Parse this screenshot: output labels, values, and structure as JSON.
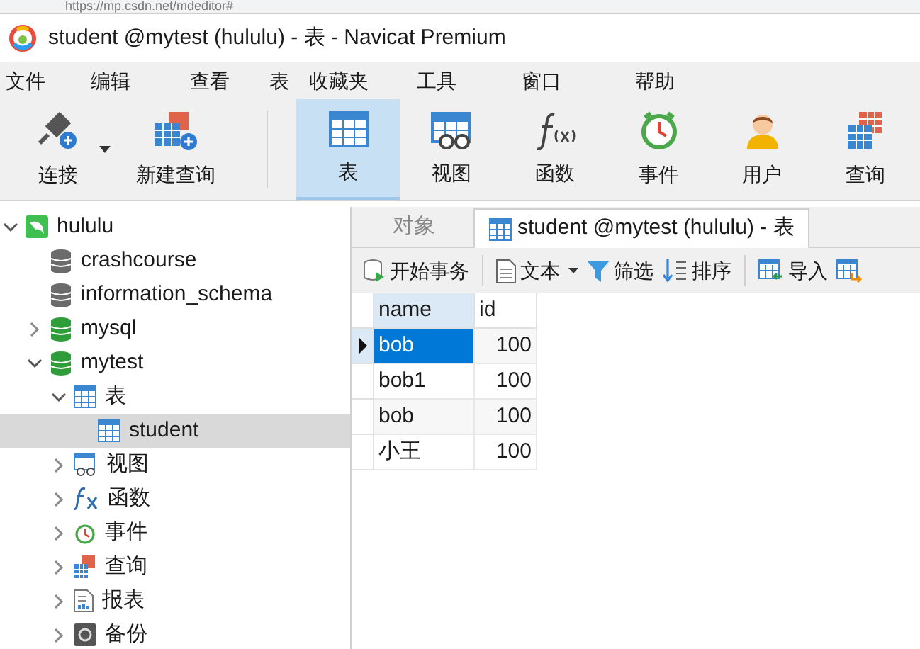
{
  "browser_url": "https://mp.csdn.net/mdeditor#",
  "window": {
    "title": "student @mytest (hululu) - 表 - Navicat Premium"
  },
  "menu": [
    "文件",
    "编辑",
    "查看",
    "表",
    "收藏夹",
    "工具",
    "窗口",
    "帮助"
  ],
  "toolbar": [
    {
      "label": "连接",
      "selected": false,
      "dropdown": true
    },
    {
      "label": "新建查询",
      "selected": false
    },
    {
      "label": "表",
      "selected": true
    },
    {
      "label": "视图",
      "selected": false
    },
    {
      "label": "函数",
      "selected": false
    },
    {
      "label": "事件",
      "selected": false
    },
    {
      "label": "用户",
      "selected": false
    },
    {
      "label": "查询",
      "selected": false
    }
  ],
  "sidebar": {
    "items": [
      {
        "kind": "server",
        "label": "hululu",
        "expanded": true,
        "selected": false,
        "children": [
          {
            "kind": "database",
            "label": "crashcourse",
            "open": false,
            "selected": false
          },
          {
            "kind": "database",
            "label": "information_schema",
            "open": false,
            "selected": false
          },
          {
            "kind": "database",
            "label": "mysql",
            "open": true,
            "expanded": false,
            "selected": false
          },
          {
            "kind": "database",
            "label": "mytest",
            "open": true,
            "expanded": true,
            "selected": false,
            "children": [
              {
                "kind": "tables",
                "label": "表",
                "expanded": true,
                "selected": false,
                "children": [
                  {
                    "kind": "table",
                    "label": "student",
                    "selected": true
                  }
                ]
              },
              {
                "kind": "views",
                "label": "视图",
                "expanded": false,
                "selected": false
              },
              {
                "kind": "functions",
                "label": "函数",
                "expanded": false,
                "selected": false
              },
              {
                "kind": "events",
                "label": "事件",
                "expanded": false,
                "selected": false
              },
              {
                "kind": "queries",
                "label": "查询",
                "expanded": false,
                "selected": false
              },
              {
                "kind": "reports",
                "label": "报表",
                "expanded": false,
                "selected": false
              },
              {
                "kind": "backups",
                "label": "备份",
                "expanded": false,
                "selected": false
              }
            ]
          }
        ]
      }
    ]
  },
  "tabs": [
    {
      "label": "对象",
      "selected": false
    },
    {
      "label": "student @mytest (hululu) - 表",
      "selected": true
    }
  ],
  "table_toolbar": [
    {
      "kind": "transaction",
      "label": "开始事务"
    },
    {
      "kind": "text",
      "label": "文本",
      "dropdown": true
    },
    {
      "kind": "filter",
      "label": "筛选"
    },
    {
      "kind": "sort",
      "label": "排序"
    },
    {
      "kind": "import",
      "label": "导入"
    },
    {
      "kind": "export"
    }
  ],
  "table": {
    "columns": [
      {
        "label": "name",
        "selected": true
      },
      {
        "label": "id",
        "selected": false
      }
    ],
    "rows": [
      {
        "selected": true,
        "cells": [
          "bob",
          "100"
        ]
      },
      {
        "selected": false,
        "cells": [
          "bob1",
          "100"
        ]
      },
      {
        "selected": false,
        "cells": [
          "bob",
          "100"
        ]
      },
      {
        "selected": false,
        "cells": [
          "小王",
          "100"
        ]
      }
    ]
  }
}
